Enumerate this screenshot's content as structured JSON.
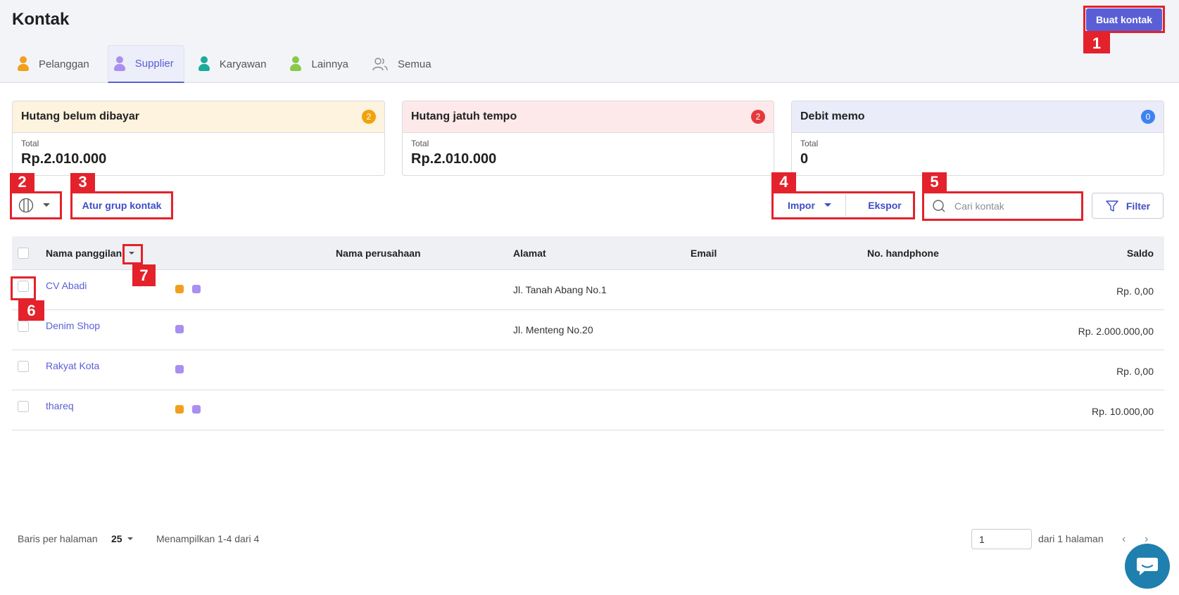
{
  "page_title": "Kontak",
  "create_button": "Buat kontak",
  "tabs": [
    {
      "label": "Pelanggan",
      "color": "#f29f1d"
    },
    {
      "label": "Supplier",
      "color": "#a98ff0"
    },
    {
      "label": "Karyawan",
      "color": "#1aab9b"
    },
    {
      "label": "Lainnya",
      "color": "#8ac94a"
    },
    {
      "label": "Semua",
      "color": "#888888"
    }
  ],
  "active_tab": "Supplier",
  "cards": [
    {
      "title": "Hutang belum dibayar",
      "badge": "2",
      "badge_color": "#f2a20c",
      "head_bg": "#fdf3de",
      "total_label": "Total",
      "total_value": "Rp.2.010.000"
    },
    {
      "title": "Hutang jatuh tempo",
      "badge": "2",
      "badge_color": "#e5383b",
      "head_bg": "#fde9ea",
      "total_label": "Total",
      "total_value": "Rp.2.010.000"
    },
    {
      "title": "Debit memo",
      "badge": "0",
      "badge_color": "#3d82f0",
      "head_bg": "#eaecfa",
      "total_label": "Total",
      "total_value": "0"
    }
  ],
  "toolbar": {
    "group_button": "Atur grup kontak",
    "import_button": "Impor",
    "export_button": "Ekspor",
    "search_placeholder": "Cari kontak",
    "filter_button": "Filter"
  },
  "table": {
    "headers": [
      "Nama panggilan",
      "Nama perusahaan",
      "Alamat",
      "Email",
      "No. handphone",
      "Saldo"
    ],
    "rows": [
      {
        "name": "CV Abadi",
        "company": "",
        "address": "Jl. Tanah Abang No.1",
        "email": "",
        "phone": "",
        "balance": "Rp. 0,00",
        "tags": [
          "#f29f1d",
          "#a98ff0"
        ]
      },
      {
        "name": "Denim Shop",
        "company": "",
        "address": "Jl. Menteng No.20",
        "email": "",
        "phone": "",
        "balance": "Rp. 2.000.000,00",
        "tags": [
          "#a98ff0"
        ]
      },
      {
        "name": "Rakyat Kota",
        "company": "",
        "address": "",
        "email": "",
        "phone": "",
        "balance": "Rp. 0,00",
        "tags": [
          "#a98ff0"
        ]
      },
      {
        "name": "thareq",
        "company": "",
        "address": "",
        "email": "",
        "phone": "",
        "balance": "Rp. 10.000,00",
        "tags": [
          "#f29f1d",
          "#a98ff0"
        ]
      }
    ]
  },
  "footer": {
    "rows_per_page_label": "Baris per halaman",
    "rows_per_page_value": "25",
    "showing_text": "Menampilkan 1-4 dari 4",
    "page_value": "1",
    "of_pages_text": "dari 1 halaman"
  },
  "annotations": [
    "1",
    "2",
    "3",
    "4",
    "5",
    "6",
    "7"
  ],
  "annotation_color": "#e3222b"
}
